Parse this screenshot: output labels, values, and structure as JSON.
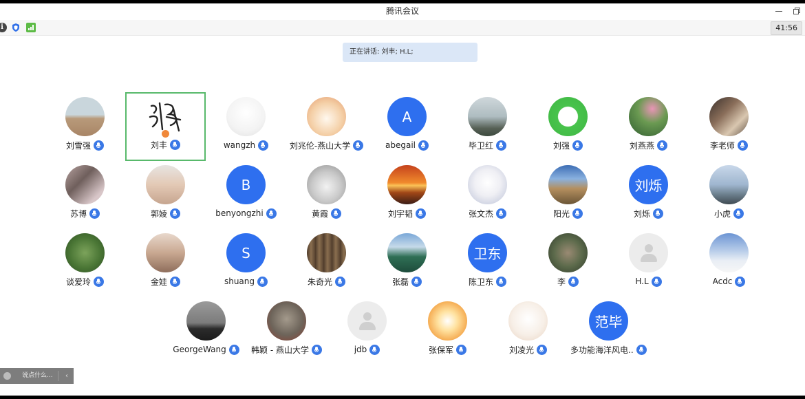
{
  "window": {
    "title": "腾讯会议"
  },
  "toolbar": {
    "timer": "41:56"
  },
  "speaking_banner": "正在讲话: 刘丰; H.L;",
  "chat": {
    "placeholder": "说点什么..."
  },
  "participants": [
    {
      "name": "刘雪强",
      "avatar": "photo",
      "bg": "linear-gradient(#c9d6dc 0%,#c9d6dc 45%,#b89a7a 55%,#a88566 100%)"
    },
    {
      "name": "刘丰",
      "avatar": "calligraphy",
      "active": true
    },
    {
      "name": "wangzh",
      "avatar": "photo",
      "bg": "radial-gradient(circle at 50% 40%,#ffffff 0%,#f3f3f3 60%,#e0e0e0 100%)"
    },
    {
      "name": "刘兆伦-燕山大学",
      "avatar": "photo",
      "bg": "radial-gradient(circle at 50% 55%,#fff8ee 0%,#f4cfa6 55%,#e3996d 100%)"
    },
    {
      "name": "abegail",
      "avatar": "letter",
      "text": "A"
    },
    {
      "name": "毕卫红",
      "avatar": "photo",
      "bg": "linear-gradient(#cfd7db 0%,#aebcc0 50%,#566055 80%,#3c4a3e 100%)"
    },
    {
      "name": "刘强",
      "avatar": "photo",
      "bg": "radial-gradient(circle at 50% 50%,#ffffff 0%,#ffffff 35%,#48c34c 37%,#3fb743 100%)"
    },
    {
      "name": "刘燕燕",
      "avatar": "photo",
      "bg": "radial-gradient(circle at 60% 30%,#e995b6 0%,#6b9a52 40%,#2f5c30 100%)"
    },
    {
      "name": "李老师",
      "avatar": "photo",
      "bg": "linear-gradient(135deg,#3a302b 0%,#8a6e5a 40%,#d9c7b0 70%,#5e4e42 100%)"
    },
    {
      "name": "苏博",
      "avatar": "photo",
      "bg": "linear-gradient(135deg,#b7a2a0 0%,#6f5f5c 40%,#d8c6c8 80%)"
    },
    {
      "name": "郭婈",
      "avatar": "photo",
      "bg": "linear-gradient(#e7e4e2 0%,#e3c9b5 50%,#c6a58f 100%)"
    },
    {
      "name": "benyongzhi",
      "avatar": "letter",
      "text": "B"
    },
    {
      "name": "黄霞",
      "avatar": "photo",
      "bg": "radial-gradient(circle at 50% 55%,#f2f2f2 0%,#c9c9c9 50%,#8e8e8e 100%)"
    },
    {
      "name": "刘宇韬",
      "avatar": "photo",
      "bg": "linear-gradient(#c5421c 0%,#f08a2c 45%,#fbc257 52%,#a24717 70%,#3b1d16 100%)"
    },
    {
      "name": "张文杰",
      "avatar": "photo",
      "bg": "radial-gradient(circle at 50% 45%,#ffffff 0%,#efeff4 45%,#b9c0d6 100%)"
    },
    {
      "name": "阳光",
      "avatar": "photo",
      "bg": "linear-gradient(#3d6eb5 0%,#8ab1df 35%,#b48f5f 60%,#6b5536 100%)"
    },
    {
      "name": "刘烁",
      "avatar": "cjk",
      "text": "刘烁"
    },
    {
      "name": "小虎",
      "avatar": "photo",
      "bg": "linear-gradient(#c9d8ea 0%,#9fb6cf 50%,#6c7f8d 75%,#3f4a52 100%)"
    },
    {
      "name": "谈爱玲",
      "avatar": "photo",
      "bg": "radial-gradient(circle at 50% 50%,#7ca35b 0%,#4a7635 55%,#2d4e22 100%)"
    },
    {
      "name": "金娃",
      "avatar": "photo",
      "bg": "linear-gradient(#e8d8cc 0%,#c9a891 50%,#8f6e5c 100%)"
    },
    {
      "name": "shuang",
      "avatar": "letter",
      "text": "S"
    },
    {
      "name": "朱奇光",
      "avatar": "photo",
      "bg": "repeating-linear-gradient(90deg,#4d3a2a 0px,#8a6e4f 6px,#5a4532 12px)"
    },
    {
      "name": "张磊",
      "avatar": "photo",
      "bg": "linear-gradient(#7aa8d8 0%,#c6dae9 35%,#2f6f55 60%,#1d4c3b 100%)"
    },
    {
      "name": "陈卫东",
      "avatar": "cjk",
      "text": "卫东"
    },
    {
      "name": "李",
      "avatar": "photo",
      "bg": "radial-gradient(circle at 50% 50%,#9a8a73 0%,#5c6a4b 50%,#2f3b2a 100%)"
    },
    {
      "name": "H.L",
      "avatar": "default"
    },
    {
      "name": "Acdc",
      "avatar": "photo",
      "bg": "linear-gradient(#6d95d4 0%,#b8cde9 45%,#e9eef5 70%,#f6f6f6 100%)"
    },
    {
      "name": "GeorgeWang",
      "avatar": "photo",
      "bg": "linear-gradient(#9a9a9a 0%,#7c7c7c 55%,#2b2b2b 70%,#1c1c1c 100%)"
    },
    {
      "name": "韩颖 - 燕山大学",
      "avatar": "photo",
      "bg": "radial-gradient(circle at 50% 45%,#a49a8c 0%,#6d645a 55%,#8c3f32 100%)"
    },
    {
      "name": "jdb",
      "avatar": "default"
    },
    {
      "name": "张保军",
      "avatar": "photo",
      "bg": "radial-gradient(circle at 50% 50%,#ffffff 0%,#ffe2a0 35%,#f4a64a 75%,#e07f2f 100%)"
    },
    {
      "name": "刘凌光",
      "avatar": "photo",
      "bg": "radial-gradient(circle at 50% 45%,#ffffff 0%,#f7efe7 55%,#e9d3c1 100%)"
    },
    {
      "name": "多功能海洋风电...",
      "avatar": "cjk",
      "text": "范毕"
    }
  ]
}
